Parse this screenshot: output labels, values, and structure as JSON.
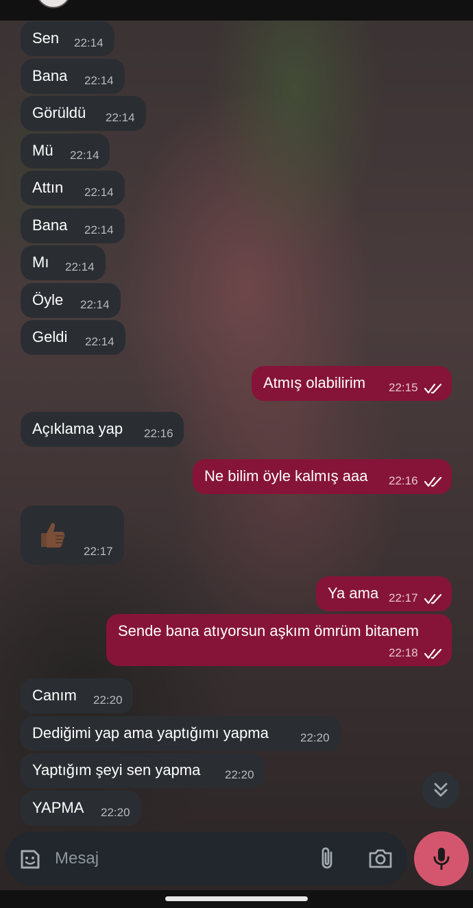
{
  "theme": {
    "incoming_bubble": "#2a2e32",
    "outgoing_bubble": "#861439",
    "mic_button": "#d4566e"
  },
  "messages": [
    {
      "dir": "in",
      "text": "Sen",
      "time": "22:14"
    },
    {
      "dir": "in",
      "text": "Bana",
      "time": "22:14"
    },
    {
      "dir": "in",
      "text": "Görüldü",
      "time": "22:14"
    },
    {
      "dir": "in",
      "text": "Mü",
      "time": "22:14"
    },
    {
      "dir": "in",
      "text": "Attın",
      "time": "22:14"
    },
    {
      "dir": "in",
      "text": "Bana",
      "time": "22:14"
    },
    {
      "dir": "in",
      "text": "Mı",
      "time": "22:14"
    },
    {
      "dir": "in",
      "text": "Öyle",
      "time": "22:14"
    },
    {
      "dir": "in",
      "text": "Geldi",
      "time": "22:14"
    },
    {
      "dir": "out",
      "text": "Atmış olabilirim",
      "time": "22:15",
      "status": "read"
    },
    {
      "dir": "in",
      "text": "Açıklama yap",
      "time": "22:16"
    },
    {
      "dir": "out",
      "text": "Ne bilim öyle kalmış aaa",
      "time": "22:16",
      "status": "read"
    },
    {
      "dir": "in",
      "sticker": "thumbs-up-emoji",
      "time": "22:17"
    },
    {
      "dir": "out",
      "text": "Ya ama",
      "time": "22:17",
      "status": "read"
    },
    {
      "dir": "out",
      "text": "Sende bana atıyorsun aşkım ömrüm bitanem",
      "time": "22:18",
      "status": "read"
    },
    {
      "dir": "in",
      "text": "Canım",
      "time": "22:20"
    },
    {
      "dir": "in",
      "text": "Dediğimi yap ama yaptığımı yapma",
      "time": "22:20"
    },
    {
      "dir": "in",
      "text": "Yaptığım şeyi sen yapma",
      "time": "22:20"
    },
    {
      "dir": "in",
      "text": "YAPMA",
      "time": "22:20"
    }
  ],
  "composer": {
    "placeholder": "Mesaj",
    "value": "",
    "sticker_icon": "sticker-icon",
    "attach_icon": "paperclip-icon",
    "camera_icon": "camera-icon",
    "mic_icon": "microphone-icon"
  },
  "scroll_down_icon": "double-chevron-down-icon"
}
